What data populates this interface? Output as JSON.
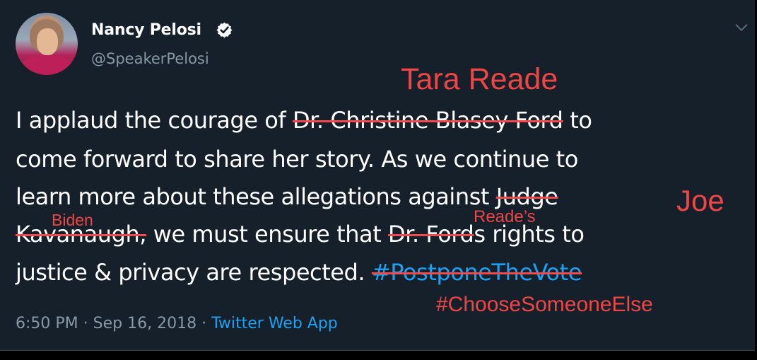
{
  "account": {
    "name": "Nancy Pelosi",
    "handle": "@SpeakerPelosi"
  },
  "tweet": {
    "line1_a": "I applaud the courage of ",
    "line1_struck": "Dr. Christine Blasey Ford",
    "line1_b": " to",
    "line2": "come forward to share her story. As we continue to",
    "line3_a": "learn more about these allegations against ",
    "line3_struck": "Judge",
    "line4_struck": "Kavanaugh,",
    "line4_a": " we must ensure that ",
    "line4_struck_name": "Dr. Ford",
    "line4_b": "s rights to",
    "line5_a": "justice & privacy are respected. ",
    "line5_hashtag": "#PostponeTheVote"
  },
  "annotations": {
    "tara": "Tara Reade",
    "joe": "Joe",
    "biden": "Biden",
    "reades": "Reade’s",
    "hashtag": "#ChooseSomeoneElse"
  },
  "meta": {
    "time": "6:50 PM",
    "date": "Sep 16, 2018",
    "source": "Twitter Web App"
  },
  "colors": {
    "background": "#15202b",
    "annotation_red": "#ee4545",
    "link_blue": "#1da1f2"
  }
}
